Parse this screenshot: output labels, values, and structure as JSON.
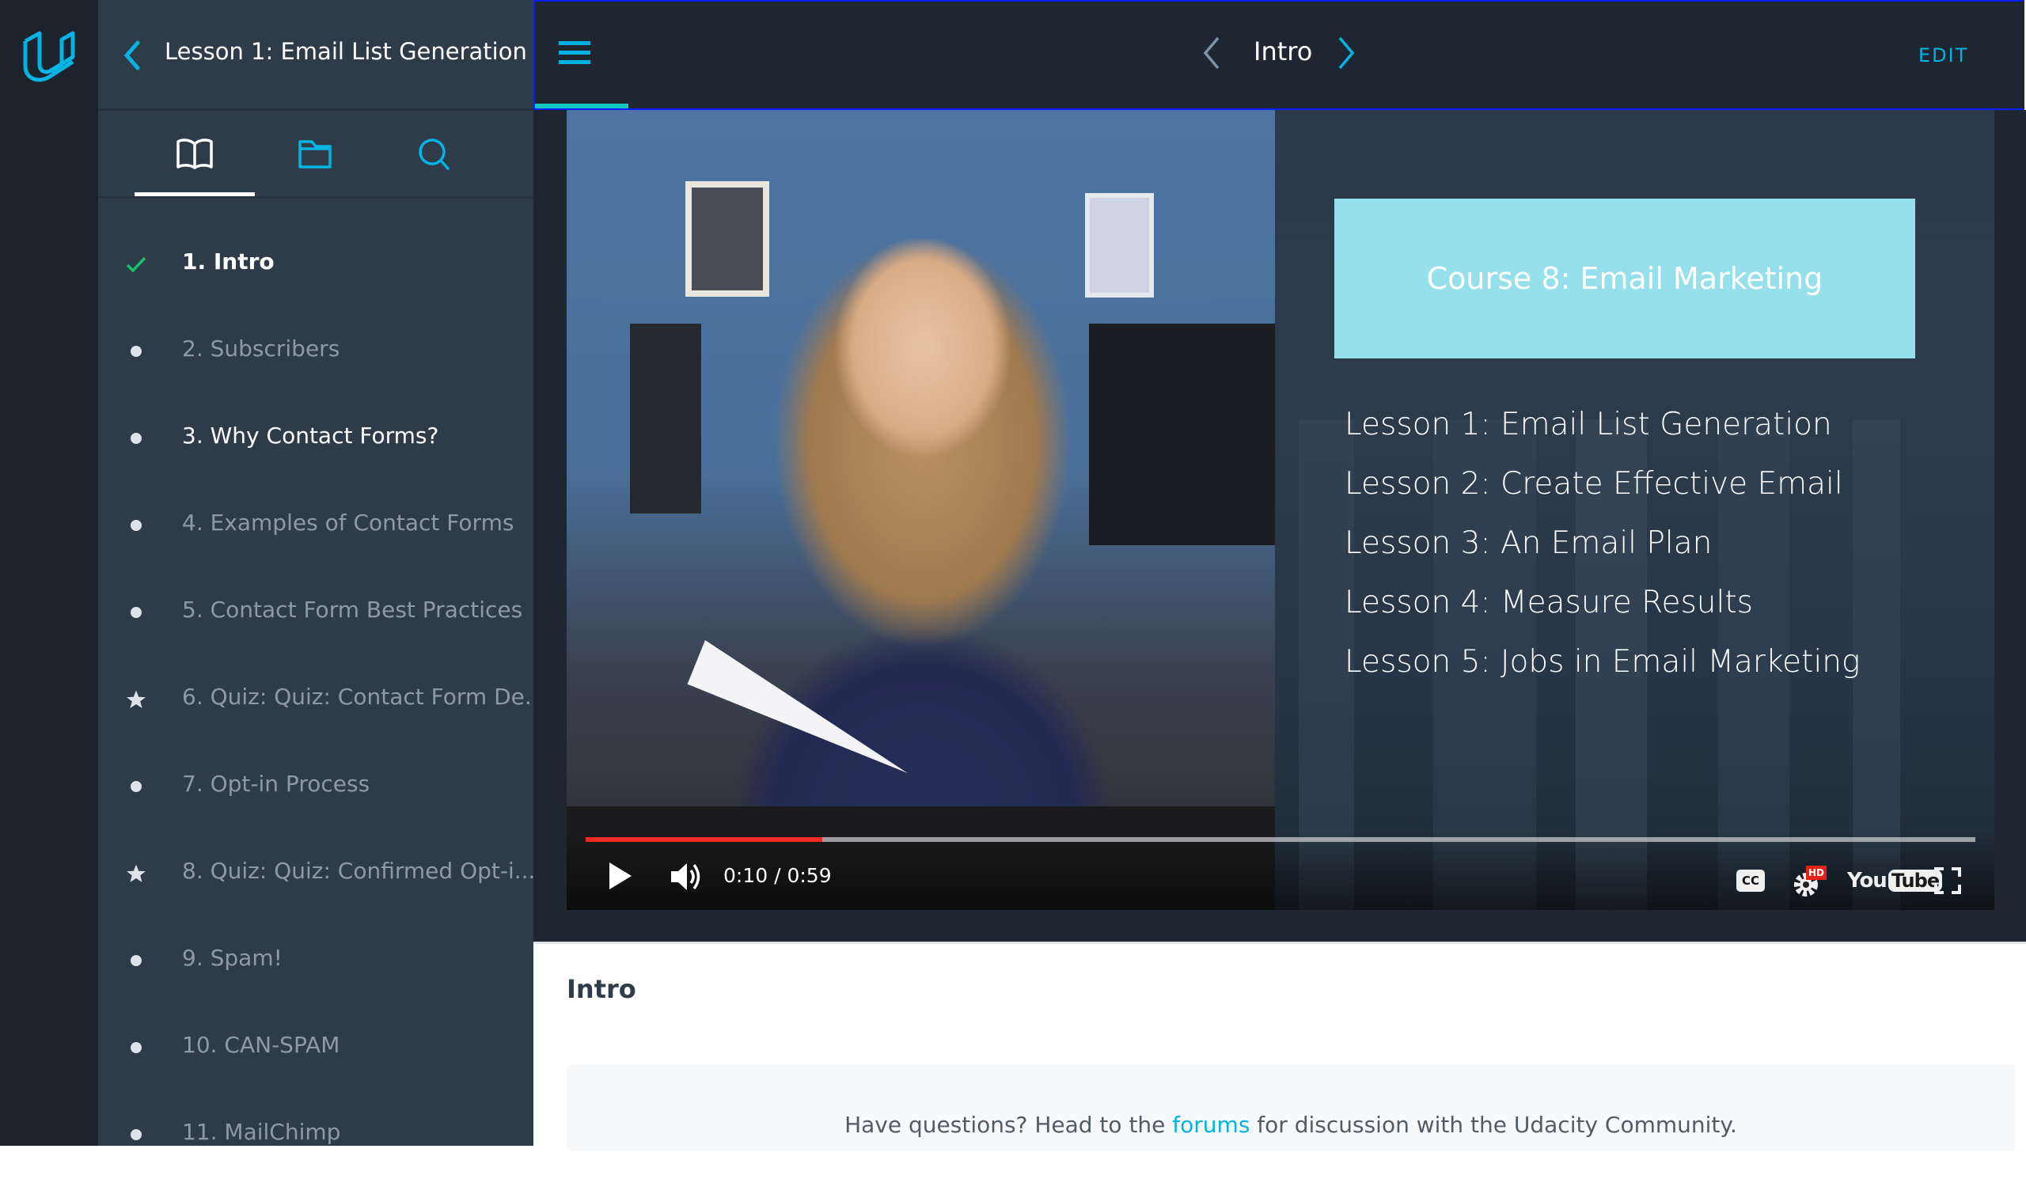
{
  "brand": {
    "logo": "udacity-logo-icon",
    "accent": "#02b3e4"
  },
  "sidebar": {
    "back_icon": "chevron-left-icon",
    "lesson_title": "Lesson 1: Email List Generation",
    "tabs": [
      {
        "name": "concepts",
        "icon": "book-icon",
        "active": true
      },
      {
        "name": "resources",
        "icon": "folder-icon",
        "active": false
      },
      {
        "name": "search",
        "icon": "search-icon",
        "active": false
      }
    ],
    "items": [
      {
        "label": "1. Intro",
        "status": "completed",
        "icon": "checkmark-icon"
      },
      {
        "label": "2. Subscribers",
        "status": "unvisited",
        "icon": "dot-icon"
      },
      {
        "label": "3. Why Contact Forms?",
        "status": "visited",
        "icon": "dot-icon"
      },
      {
        "label": "4. Examples of Contact Forms",
        "status": "unvisited",
        "icon": "dot-icon"
      },
      {
        "label": "5. Contact Form Best Practices",
        "status": "unvisited",
        "icon": "dot-icon"
      },
      {
        "label": "6. Quiz: Quiz: Contact Form De...",
        "status": "unvisited",
        "icon": "star-icon"
      },
      {
        "label": "7. Opt-in Process",
        "status": "unvisited",
        "icon": "dot-icon"
      },
      {
        "label": "8. Quiz: Quiz: Confirmed Opt-i...",
        "status": "unvisited",
        "icon": "star-icon"
      },
      {
        "label": "9. Spam!",
        "status": "unvisited",
        "icon": "dot-icon"
      },
      {
        "label": "10. CAN-SPAM",
        "status": "unvisited",
        "icon": "dot-icon"
      },
      {
        "label": "11. MailChimp",
        "status": "unvisited",
        "icon": "dot-icon"
      }
    ]
  },
  "topbar": {
    "menu_icon": "hamburger-menu-icon",
    "concept_title": "Intro",
    "prev_icon": "chevron-left-icon",
    "next_icon": "chevron-right-icon",
    "edit_label": "EDIT",
    "lesson_progress": 0.0625
  },
  "video": {
    "slide_title": "Course 8: Email Marketing",
    "slide_lessons": [
      "Lesson 1: Email List Generation",
      "Lesson 2: Create Effective Email",
      "Lesson 3: An Email Plan",
      "Lesson 4: Measure Results",
      "Lesson 5: Jobs in Email Marketing"
    ],
    "current_time": "0:10",
    "duration": "0:59",
    "time_display": "0:10 / 0:59",
    "played_fraction": 0.17,
    "cc_label": "CC",
    "hd_badge": "HD",
    "youtube_you": "You",
    "youtube_tube": "Tube",
    "colors": {
      "played": "#f12b24",
      "slide_box": "#95e0ea"
    }
  },
  "content": {
    "heading": "Intro",
    "forum_prefix": "Have questions? Head to the ",
    "forum_link": "forums",
    "forum_suffix": " for discussion with the Udacity Community."
  }
}
